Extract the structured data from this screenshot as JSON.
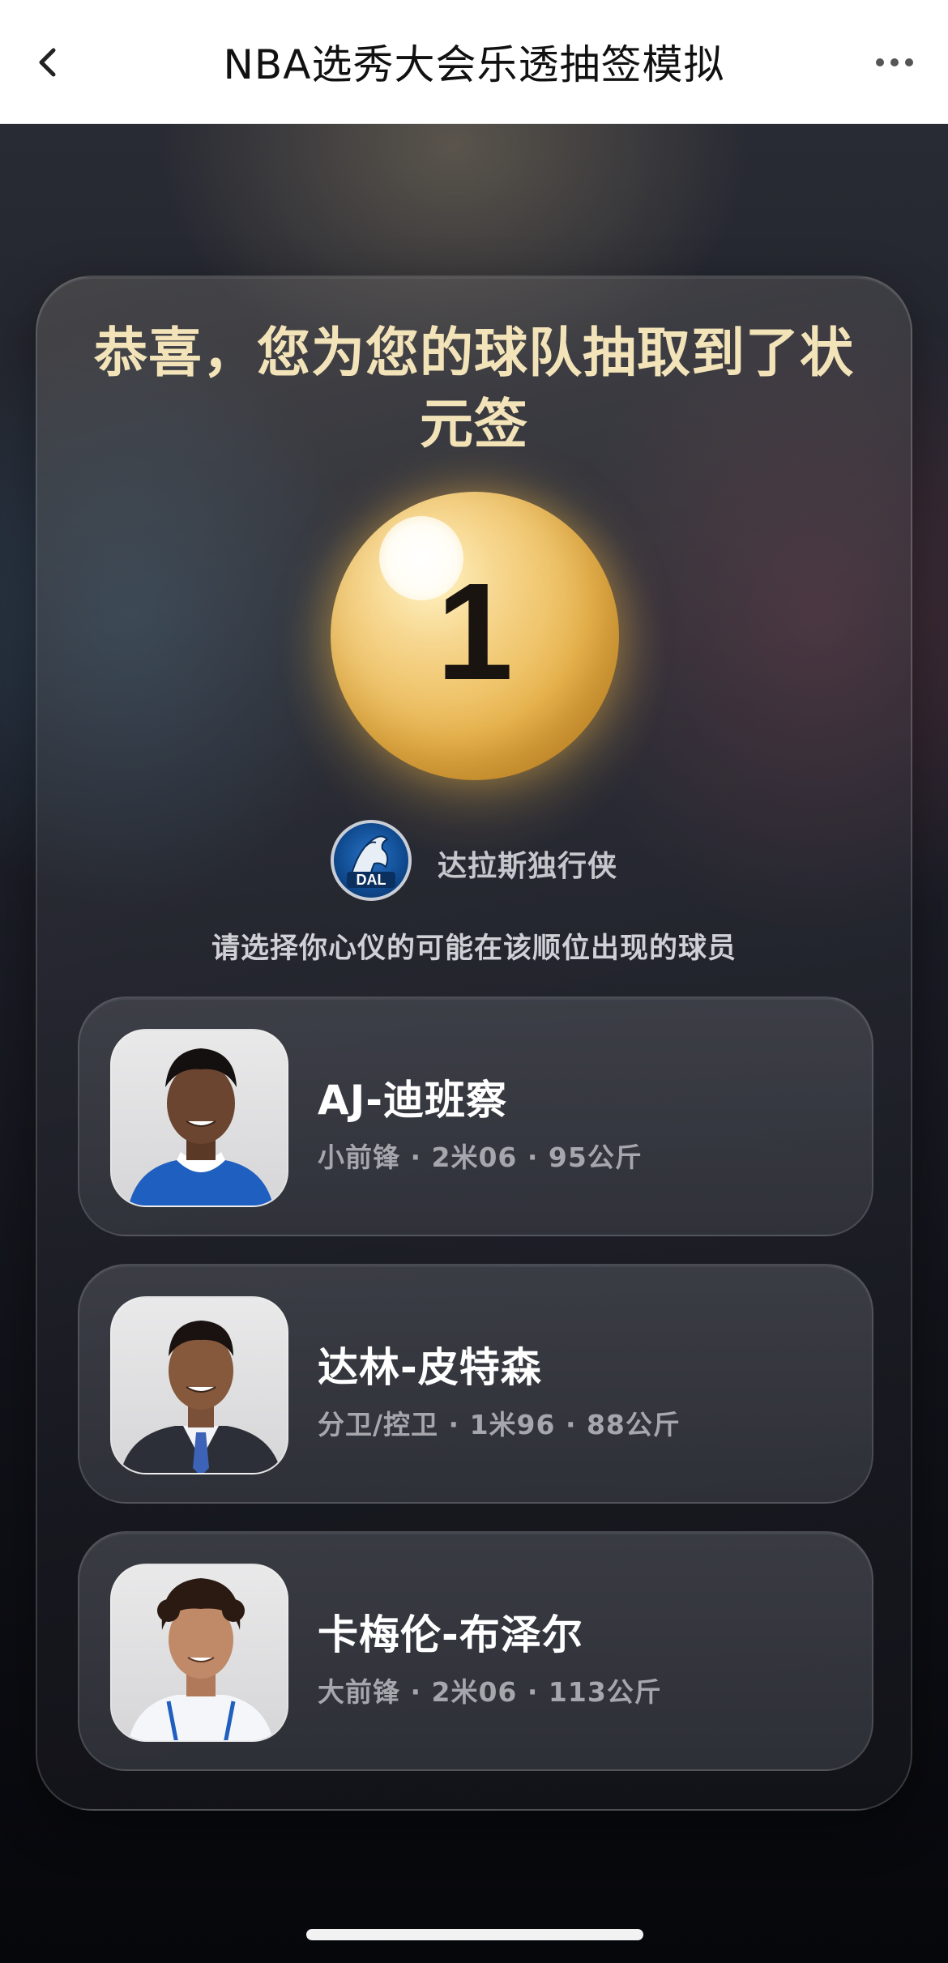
{
  "navbar": {
    "title": "NBA选秀大会乐透抽签模拟",
    "back_icon": "chevron-left-icon",
    "more_icon": "more-dots-icon"
  },
  "result": {
    "headline": "恭喜，您为您的球队抽取到了状元签",
    "pick_number": "1",
    "ball_color": "#e9b650"
  },
  "team": {
    "name": "达拉斯独行侠",
    "logo_text": "DAL"
  },
  "prompt": "请选择你心仪的可能在该顺位出现的球员",
  "players": [
    {
      "name": "AJ-迪班察",
      "info": "小前锋 · 2米06 · 95公斤",
      "jersey_color": "#1f5fbf"
    },
    {
      "name": "达林-皮特森",
      "info": "分卫/控卫 · 1米96 · 88公斤",
      "jersey_color": "#2c2f38"
    },
    {
      "name": "卡梅伦-布泽尔",
      "info": "大前锋 · 2米06 · 113公斤",
      "jersey_color": "#f4f6fa"
    }
  ],
  "colors": {
    "headline": "#f3e3b8",
    "accent_gold": "#e9b650"
  }
}
